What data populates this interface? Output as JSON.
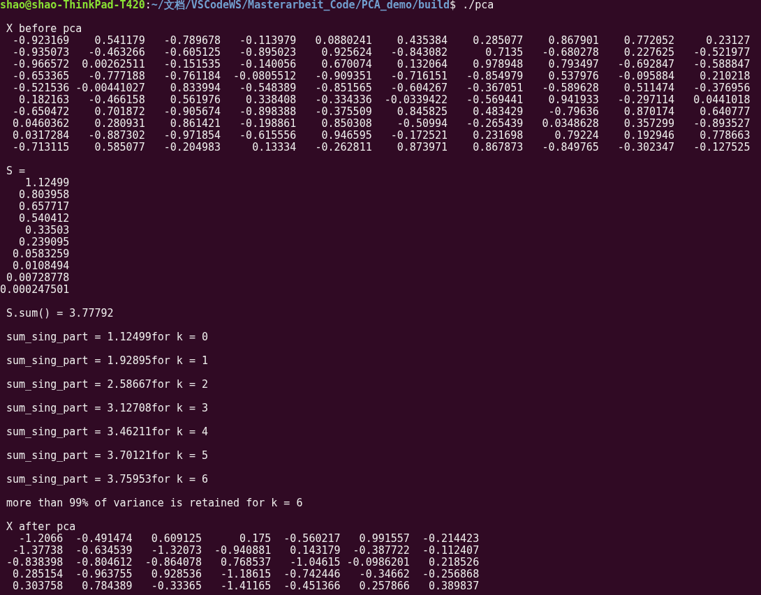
{
  "terminal": {
    "prompt": {
      "user_host": "shao@shao-ThinkPad-T420",
      "separator": ":",
      "path": "~/文档/VSCodeWS/Masterarbeit_Code/PCA_demo/build",
      "symbol": "$",
      "command": "./pca"
    },
    "sections": [
      {
        "kind": "matrix",
        "title": "X before pca",
        "rows": [
          [
            "-0.923169",
            "0.541179",
            "-0.789678",
            "-0.113979",
            "0.0880241",
            "0.435384",
            "0.285077",
            "0.867901",
            "0.772052",
            "0.23127"
          ],
          [
            "-0.935073",
            "-0.463266",
            "-0.605125",
            "-0.895023",
            "0.925624",
            "-0.843082",
            "0.7135",
            "-0.680278",
            "0.227625",
            "-0.521977"
          ],
          [
            "-0.966572",
            "0.00262511",
            "-0.151535",
            "-0.140056",
            "0.670074",
            "0.132064",
            "0.978948",
            "0.793497",
            "-0.692847",
            "-0.588847"
          ],
          [
            "-0.653365",
            "-0.777188",
            "-0.761184",
            "-0.0805512",
            "-0.909351",
            "-0.716151",
            "-0.854979",
            "0.537976",
            "-0.095884",
            "0.210218"
          ],
          [
            "-0.521536",
            "-0.00441027",
            "0.833994",
            "-0.548389",
            "-0.851565",
            "-0.604267",
            "-0.367051",
            "-0.589628",
            "0.511474",
            "-0.376956"
          ],
          [
            "0.182163",
            "-0.466158",
            "0.561976",
            "0.338408",
            "-0.334336",
            "-0.0339422",
            "-0.569441",
            "0.941933",
            "-0.297114",
            "0.0441018"
          ],
          [
            "-0.650472",
            "0.701872",
            "-0.905674",
            "-0.898388",
            "-0.375509",
            "0.845825",
            "0.483429",
            "-0.79636",
            "0.870174",
            "0.640777"
          ],
          [
            "0.0460362",
            "0.280931",
            "0.861421",
            "-0.198861",
            "0.850308",
            "-0.50994",
            "-0.265439",
            "0.0348628",
            "0.357299",
            "-0.893527"
          ],
          [
            "0.0317284",
            "-0.887302",
            "-0.971854",
            "-0.615556",
            "0.946595",
            "-0.172521",
            "0.231698",
            "0.79224",
            "0.192946",
            "0.778663"
          ],
          [
            "-0.713115",
            "0.585077",
            "-0.204983",
            "0.13334",
            "-0.262811",
            "0.873971",
            "0.867873",
            "-0.849765",
            "-0.302347",
            "-0.127525"
          ]
        ]
      },
      {
        "kind": "matrix",
        "title": "S =",
        "rows": [
          [
            "1.12499"
          ],
          [
            "0.803958"
          ],
          [
            "0.657717"
          ],
          [
            "0.540412"
          ],
          [
            "0.33503"
          ],
          [
            "0.239095"
          ],
          [
            "0.0583259"
          ],
          [
            "0.0108494"
          ],
          [
            "0.00728778"
          ],
          [
            "0.000247501"
          ]
        ]
      },
      {
        "kind": "line",
        "text": "S.sum() = 3.77792"
      },
      {
        "kind": "line",
        "text": "sum_sing_part = 1.12499for k = 0"
      },
      {
        "kind": "line",
        "text": "sum_sing_part = 1.92895for k = 1"
      },
      {
        "kind": "line",
        "text": "sum_sing_part = 2.58667for k = 2"
      },
      {
        "kind": "line",
        "text": "sum_sing_part = 3.12708for k = 3"
      },
      {
        "kind": "line",
        "text": "sum_sing_part = 3.46211for k = 4"
      },
      {
        "kind": "line",
        "text": "sum_sing_part = 3.70121for k = 5"
      },
      {
        "kind": "line",
        "text": "sum_sing_part = 3.75953for k = 6"
      },
      {
        "kind": "line",
        "text": "more than 99% of variance is retained for k = 6"
      },
      {
        "kind": "matrix",
        "title": "X after pca",
        "rows": [
          [
            "-1.2066",
            "-0.491474",
            "0.609125",
            "0.175",
            "-0.560217",
            "0.991557",
            "-0.214423"
          ],
          [
            "-1.37738",
            "-0.634539",
            "-1.32073",
            "-0.940881",
            "0.143179",
            "-0.387722",
            "-0.112407"
          ],
          [
            "-0.838398",
            "-0.804612",
            "-0.864078",
            "0.768537",
            "-1.04615",
            "-0.0986201",
            "0.218526"
          ],
          [
            "0.285154",
            "-0.963755",
            "0.928536",
            "-1.18615",
            "-0.742446",
            "-0.34662",
            "-0.256868"
          ],
          [
            "0.303758",
            "0.784389",
            "-0.33365",
            "-1.41165",
            "-0.451366",
            "0.257866",
            "0.389837"
          ]
        ]
      }
    ]
  }
}
